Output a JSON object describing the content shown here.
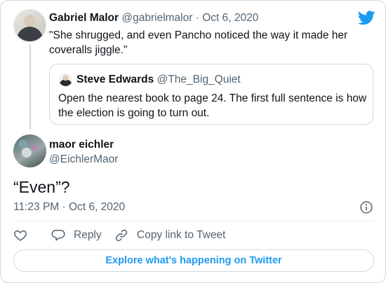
{
  "parent_tweet": {
    "name": "Gabriel Malor",
    "handle": "@gabrielmalor",
    "separator": "·",
    "date": "Oct 6, 2020",
    "text": "\"She shrugged, and even Pancho noticed the way it made her coveralls jiggle.\""
  },
  "quoted_tweet": {
    "name": "Steve Edwards",
    "handle": "@The_Big_Quiet",
    "text": "Open the nearest book to page 24. The first full sentence is how the election is going to turn out."
  },
  "main_tweet": {
    "name": "maor eichler",
    "handle": "@EichlerMaor",
    "text": "“Even”?",
    "timestamp": "11:23 PM · Oct 6, 2020"
  },
  "actions": {
    "reply": "Reply",
    "copy_link": "Copy link to Tweet"
  },
  "explore_label": "Explore what's happening on Twitter",
  "icons": {
    "brand": "twitter-bird-icon",
    "info": "info-icon",
    "like": "heart-icon",
    "reply": "speech-bubble-icon",
    "copy": "link-icon"
  },
  "colors": {
    "accent": "#1d9bf0",
    "muted_text": "#536471",
    "border": "#cfd9de"
  }
}
